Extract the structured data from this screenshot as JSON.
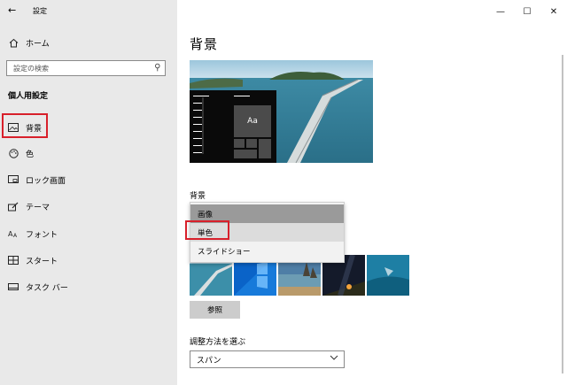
{
  "window": {
    "title": "設定",
    "back_glyph": "←",
    "minimize_glyph": "—",
    "maximize_glyph": "☐",
    "close_glyph": "✕"
  },
  "sidebar": {
    "home": {
      "label": "ホーム",
      "icon": "home-icon"
    },
    "search": {
      "placeholder": "設定の検索",
      "icon": "search-icon"
    },
    "section_heading": "個人用設定",
    "items": [
      {
        "label": "背景",
        "icon": "image-icon",
        "selected": true
      },
      {
        "label": "色",
        "icon": "palette-icon"
      },
      {
        "label": "ロック画面",
        "icon": "lock-screen-icon"
      },
      {
        "label": "テーマ",
        "icon": "theme-brush-icon"
      },
      {
        "label": "フォント",
        "icon": "font-icon"
      },
      {
        "label": "スタート",
        "icon": "start-icon"
      },
      {
        "label": "タスク バー",
        "icon": "taskbar-icon"
      }
    ]
  },
  "main": {
    "page_title": "背景",
    "preview_sample_text": "Aa",
    "background_label": "背景",
    "background_dropdown": {
      "options": [
        "画像",
        "単色",
        "スライドショー"
      ],
      "selected": "画像",
      "hovered": "単色"
    },
    "browse_button": "参照",
    "fit_label": "調整方法を選ぶ",
    "fit_value": "スパン"
  },
  "colors": {
    "sidebar_bg": "#e9e9e9",
    "highlight": "#d8202b",
    "selected_option": "#9a9a9a",
    "hover_option": "#dcdcdc",
    "button_bg": "#cccccc"
  }
}
